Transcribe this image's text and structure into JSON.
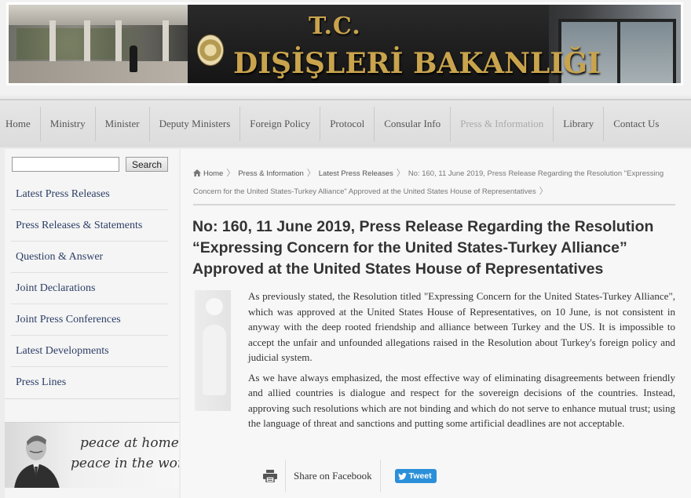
{
  "banner": {
    "tc": "T.C.",
    "ministry": "DIŞİŞLERİ BAKANLIĞI"
  },
  "nav": {
    "items": [
      {
        "label": "Home"
      },
      {
        "label": "Ministry"
      },
      {
        "label": "Minister"
      },
      {
        "label": "Deputy Ministers"
      },
      {
        "label": "Foreign Policy"
      },
      {
        "label": "Protocol"
      },
      {
        "label": "Consular Info"
      },
      {
        "label": "Press & Information",
        "active": true
      },
      {
        "label": "Library"
      },
      {
        "label": "Contact Us"
      }
    ]
  },
  "sidebar": {
    "search": {
      "value": "",
      "button": "Search"
    },
    "items": [
      {
        "label": "Latest Press Releases"
      },
      {
        "label": "Press Releases & Statements"
      },
      {
        "label": "Question & Answer"
      },
      {
        "label": "Joint Declarations"
      },
      {
        "label": "Joint Press Conferences"
      },
      {
        "label": "Latest Developments"
      },
      {
        "label": "Press Lines"
      }
    ],
    "quote": {
      "line1": "peace at home",
      "line2": "peace in the world"
    }
  },
  "breadcrumb": {
    "home": "Home",
    "items": [
      "Press & Information",
      "Latest Press Releases"
    ],
    "current": "No: 160, 11 June 2019, Press Release Regarding the Resolution \"Expressing Concern for the United States-Turkey Alliance\" Approved at the United States House of Representatives"
  },
  "article": {
    "title": "No: 160, 11 June 2019, Press Release Regarding the Resolution “Expressing Concern for the United States-Turkey Alliance” Approved at the United States House of Representatives",
    "paragraphs": [
      "As previously stated, the Resolution titled \"Expressing Concern for the United States-Turkey Alliance\", which was approved at the United States House of Representatives, on 10 June, is not consistent in anyway with the deep rooted friendship and alliance between Turkey and the US. It is impossible to accept the unfair and unfounded allegations raised in the Resolution about Turkey's foreign policy and judicial system.",
      "As we have always emphasized, the most effective way of eliminating disagreements between friendly and allied countries is dialogue and respect for the sovereign decisions of the countries. Instead, approving such resolutions which are not binding and which do not serve to enhance mutual trust; using the language of threat and sanctions and putting some artificial deadlines are not acceptable."
    ]
  },
  "share": {
    "facebook": "Share on Facebook",
    "tweet": "Tweet"
  },
  "colors": {
    "link": "#2c3e66",
    "nav_text": "#555555",
    "nav_active": "#aaaaaa",
    "tweet": "#2b8fd9",
    "banner_gold": "#c9a44d"
  }
}
